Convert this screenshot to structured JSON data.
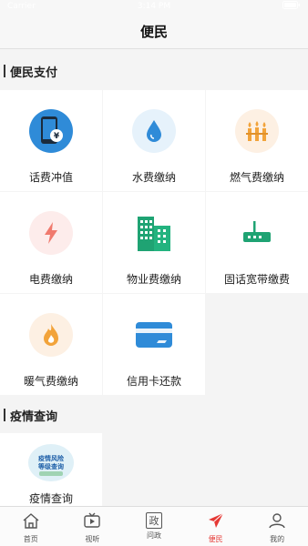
{
  "status_bar": {
    "carrier": "Carrier",
    "time": "3:14 PM"
  },
  "nav": {
    "title": "便民"
  },
  "sections": [
    {
      "title": "便民支付"
    },
    {
      "title": "疫情查询"
    }
  ],
  "payment_items": [
    {
      "label": "话费冲值",
      "icon": "phone-bill-icon"
    },
    {
      "label": "水费缴纳",
      "icon": "water-drop-icon"
    },
    {
      "label": "燃气费缴纳",
      "icon": "gas-flame-icon"
    },
    {
      "label": "电费缴纳",
      "icon": "lightning-icon"
    },
    {
      "label": "物业费缴纳",
      "icon": "buildings-icon"
    },
    {
      "label": "固话宽带缴费",
      "icon": "router-icon"
    },
    {
      "label": "暖气费缴纳",
      "icon": "fire-icon"
    },
    {
      "label": "信用卡还款",
      "icon": "credit-card-icon"
    }
  ],
  "epidemic": {
    "label": "疫情查询",
    "badge_lines": [
      "疫情风险",
      "等级查询"
    ]
  },
  "tabs": [
    {
      "label": "首页",
      "icon": "home-icon",
      "active": false
    },
    {
      "label": "视听",
      "icon": "tv-icon",
      "active": false
    },
    {
      "label": "问政",
      "icon": "zheng-icon",
      "glyph": "政",
      "active": false
    },
    {
      "label": "便民",
      "icon": "paper-plane-icon",
      "active": true
    },
    {
      "label": "我的",
      "icon": "user-icon",
      "active": false
    }
  ],
  "colors": {
    "accent": "#e53935",
    "blue": "#2f8bd8",
    "green": "#1fa373",
    "orange": "#f2a33a",
    "light_orange_bg": "#fdf0e3",
    "light_blue_bg": "#e6f2fb",
    "light_red_bg": "#fdeceb"
  }
}
